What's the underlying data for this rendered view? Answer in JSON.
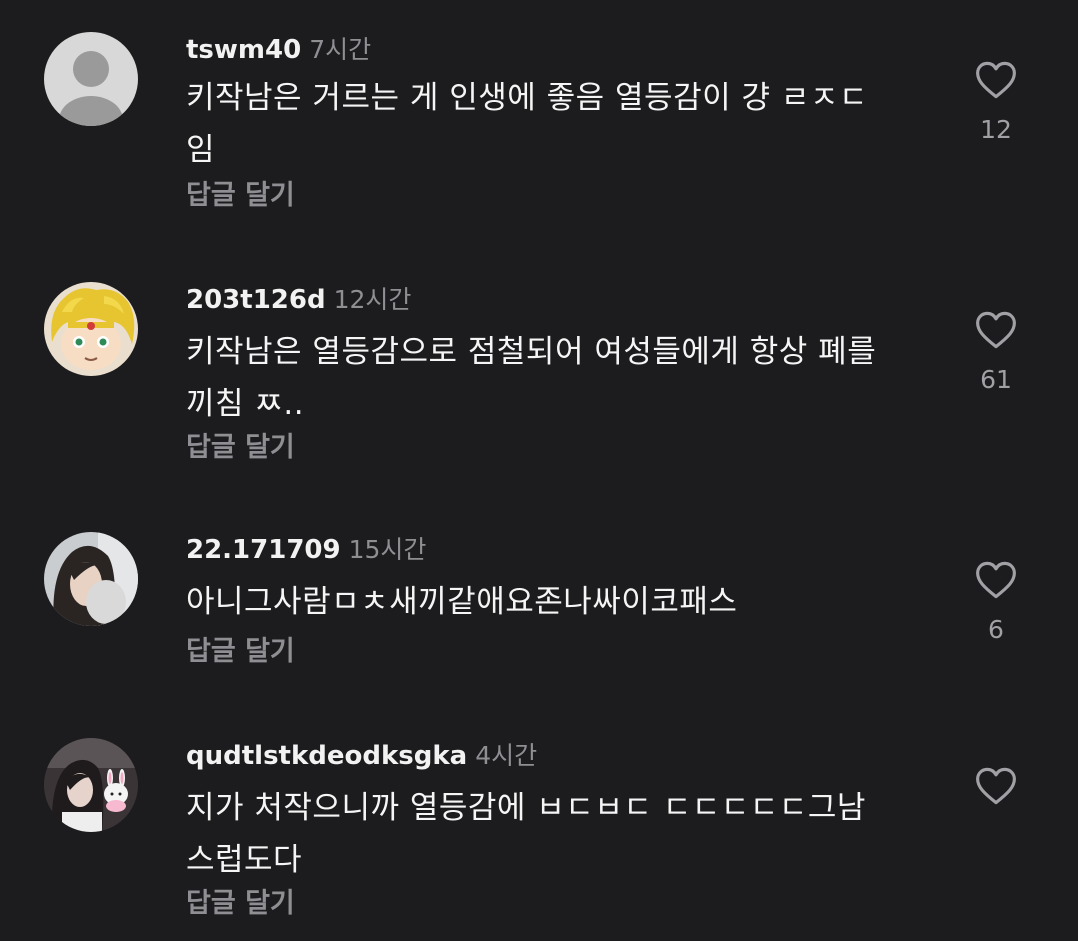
{
  "comments": [
    {
      "username": "tswm40",
      "time": "7시간",
      "text": "키작남은 거르는 게 인생에 좋음 열등감이 걍 ㄹㅈㄷ임",
      "reply_label": "답글 달기",
      "likes": "12",
      "avatar": "default-person-avatar"
    },
    {
      "username": "203t126d",
      "time": "12시간",
      "text": "키작남은 열등감으로 점철되어 여성들에게 항상 폐를 끼침 ㅉ..",
      "reply_label": "답글 달기",
      "likes": "61",
      "avatar": "blonde-cartoon-character-avatar"
    },
    {
      "username": "22.171709",
      "time": "15시간",
      "text": "아니그사람ㅁㅊ새끼같애요존나싸이코패스",
      "reply_label": "답글 달기",
      "likes": "6",
      "avatar": "person-photo-avatar"
    },
    {
      "username": "qudtlstkdeodksgka",
      "time": "4시간",
      "text": "지가 처작으니까 열등감에 ㅂㄷㅂㄷ ㄷㄷㄷㄷㄷ그남스럽도다",
      "reply_label": "답글 달기",
      "likes": "",
      "avatar": "person-with-bunny-photo-avatar"
    }
  ],
  "icons": {
    "like": "heart-outline-icon"
  },
  "colors": {
    "background": "#1c1c1e",
    "secondary_text": "#8e8e93",
    "primary_text": "#f5f5f5"
  }
}
